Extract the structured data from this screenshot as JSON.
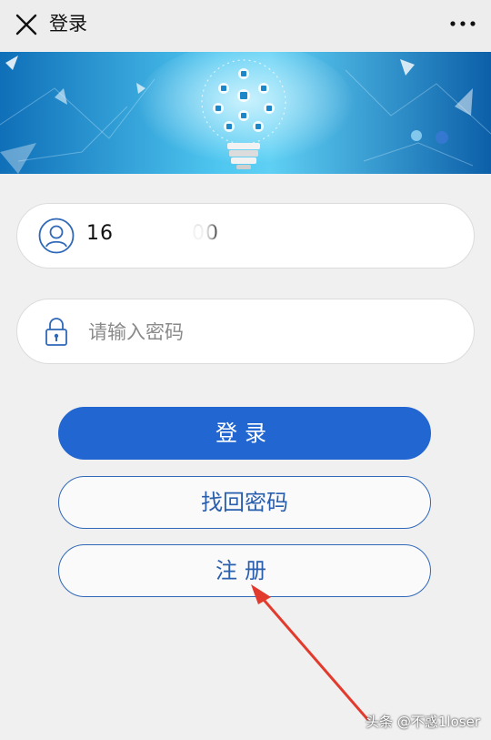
{
  "topbar": {
    "title": "登录",
    "close_icon": "close-icon",
    "more_icon": "more-dots-icon"
  },
  "banner": {
    "description_icon": "lightbulb-tech-banner"
  },
  "form": {
    "username": {
      "value": "16",
      "value_tail": "00",
      "icon": "user-icon"
    },
    "password": {
      "placeholder": "请输入密码",
      "icon": "lock-icon"
    }
  },
  "buttons": {
    "login": "登录",
    "recover": "找回密码",
    "register": "注册"
  },
  "watermark": "头条 @不惑1loser",
  "colors": {
    "primary": "#2266d2",
    "outline": "#2f68b8",
    "arrow": "#e23b2e"
  }
}
